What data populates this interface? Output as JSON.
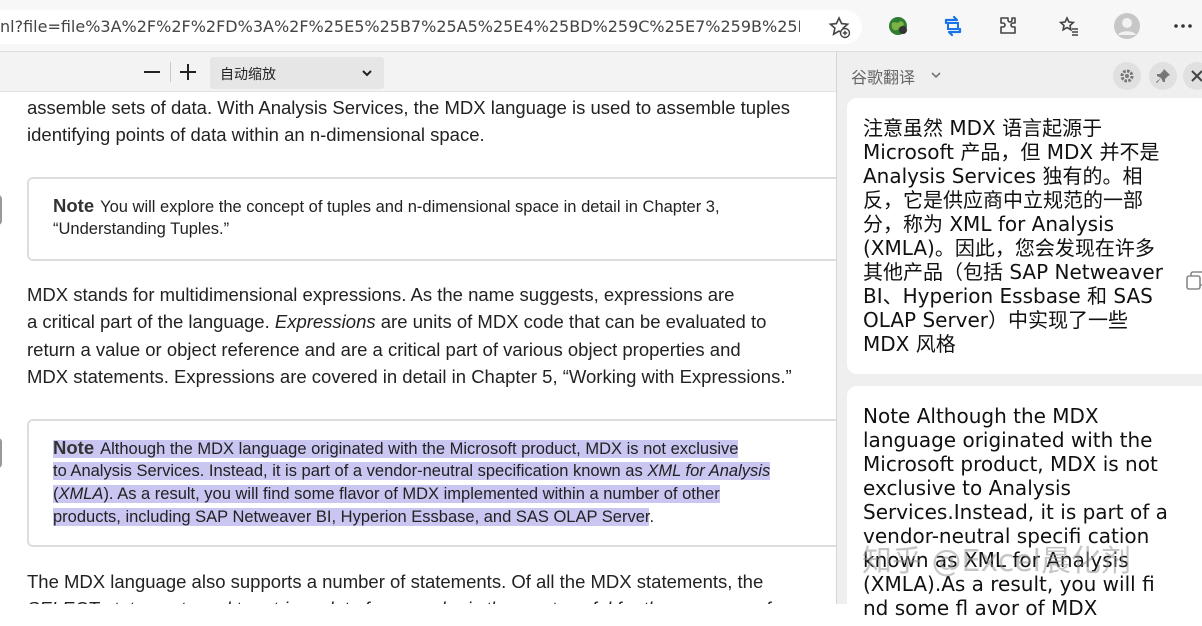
{
  "browser": {
    "url": "nl?file=file%3A%2F%2F%2FD%3A%2F%25E5%25B7%25A5%25E4%25BD%259C%25E7%259B%25B8%2..."
  },
  "pdf_toolbar": {
    "zoom_out": "−",
    "zoom_in": "+",
    "zoom_value": "自动缩放"
  },
  "document": {
    "intro_lines": [
      "assemble sets of data. With Analysis Services, the MDX language is used to assemble tuples",
      "identifying points of data within an n-dimensional space."
    ],
    "note1": {
      "title": "Note",
      "line1": "You will explore the concept of tuples and n-dimensional space in detail in Chapter 3,",
      "line2": "“Understanding Tuples.”"
    },
    "para2": {
      "line1": "MDX stands for multidimensional expressions. As the name suggests, expressions are",
      "line2_a": "a critical part of the language. ",
      "line2_i": "Expressions",
      "line2_b": " are units of MDX code that can be evaluated to",
      "line3": "return a value or object reference and are a critical part of various object properties and",
      "line4": "MDX statements. Expressions are covered in detail in Chapter 5, “Working with Expressions.”"
    },
    "note2": {
      "title": "Note",
      "line1": "Although the MDX language originated with the Microsoft product, MDX is not exclusive",
      "line2_a": "to Analysis Services. Instead, it is part of a vendor-neutral specification known as ",
      "line2_i": "XML for Analysis",
      "line3_a": "(",
      "line3_i": "XMLA",
      "line3_b": "). As a result, you will find some flavor of MDX implemented within a number of other",
      "line4": "products, including SAP Netweaver BI, Hyperion Essbase, and SAS OLAP Server",
      "line4_end": "."
    },
    "para3": {
      "line1": "The MDX language also supports a number of statements. Of all the MDX statements, the",
      "line2": "SELECT statement used to retrieve data from a cube is the most useful for the purposes of"
    }
  },
  "translate_panel": {
    "title": "谷歌翻译",
    "translation_lines": [
      "注意虽然 MDX 语言起源于",
      "Microsoft 产品，但 MDX 并不是",
      "Analysis Services 独有的。相",
      "反，它是供应商中立规范的一部",
      "分，称为 XML for Analysis",
      "(XMLA)。因此，您会发现在许多",
      "其他产品（包括 SAP Netweaver",
      "BI、Hyperion Essbase 和 SAS",
      "OLAP Server）中实现了一些",
      "MDX 风格"
    ],
    "source_lines": [
      "Note  Although the MDX",
      "language originated with the",
      "Microsoft product, MDX is not",
      "exclusive  to Analysis",
      "Services.Instead, it is part of a",
      "vendor-neutral specifi cation",
      "known as XML for Analysis",
      "(XMLA).As a result, you will fi",
      "nd some fl avor of MDX"
    ],
    "watermark": "知乎 @Excel晨化剂"
  },
  "colors": {
    "highlight": "#c9c6f2",
    "panel_bg": "#efefef",
    "accent_blue": "#1a73e8"
  }
}
